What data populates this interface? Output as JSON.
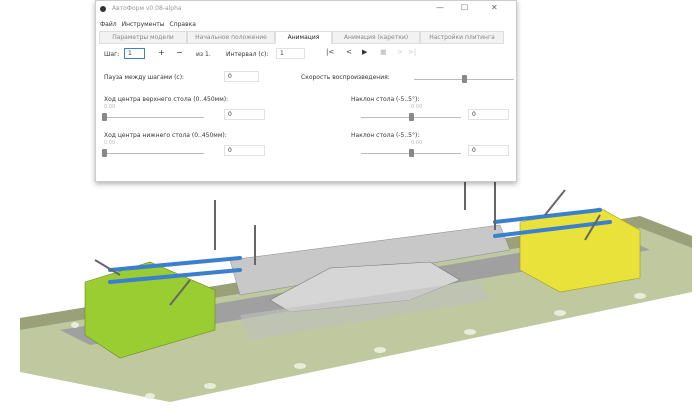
{
  "window": {
    "title": "АвтоФорм v0.08-alpha",
    "minimize": "—",
    "maximize": "☐",
    "close": "✕"
  },
  "menu": [
    "Файл",
    "Инструменты",
    "Справка"
  ],
  "tabs": [
    "Параметры модели",
    "Начальное положение",
    "Анимация",
    "Анимация (каретки)",
    "Настройки плитинга"
  ],
  "active_tab": "Анимация",
  "toolbar": {
    "step_label": "Шаг:",
    "step_value": "1",
    "plus": "+",
    "minus": "−",
    "of_label": "из 1.",
    "interval_label": "Интервал (с):",
    "interval_value": "1",
    "buttons": {
      "first": "|<",
      "prev": "<",
      "play": "▶",
      "stop": "■",
      "next": ">",
      "last": ">|"
    }
  },
  "pause": {
    "label": "Пауза между шагами (с):",
    "value": "0"
  },
  "speed": {
    "label": "Скорость воспроизведения:",
    "value_fraction": 0.5
  },
  "sliders": [
    {
      "label": "Ход центра верхнего стола (0..450мм):",
      "tick": "0.00",
      "value": "0",
      "fraction": 0
    },
    {
      "label": "Наклон стола (-5..5°):",
      "tick": "0.00",
      "value": "0",
      "fraction": 0.5
    },
    {
      "label": "Ход центра нижнего стола (0..450мм):",
      "tick": "0.00",
      "value": "0",
      "fraction": 0
    },
    {
      "label": "Наклон стола (-5..5°):",
      "tick": "0.00",
      "value": "0",
      "fraction": 0.5
    }
  ],
  "colors": {
    "green": "#9acd32",
    "yellow": "#e8e23a",
    "olive": "#8a9a50",
    "blue": "#3a7fd0",
    "gray": "#b8b8b8"
  }
}
